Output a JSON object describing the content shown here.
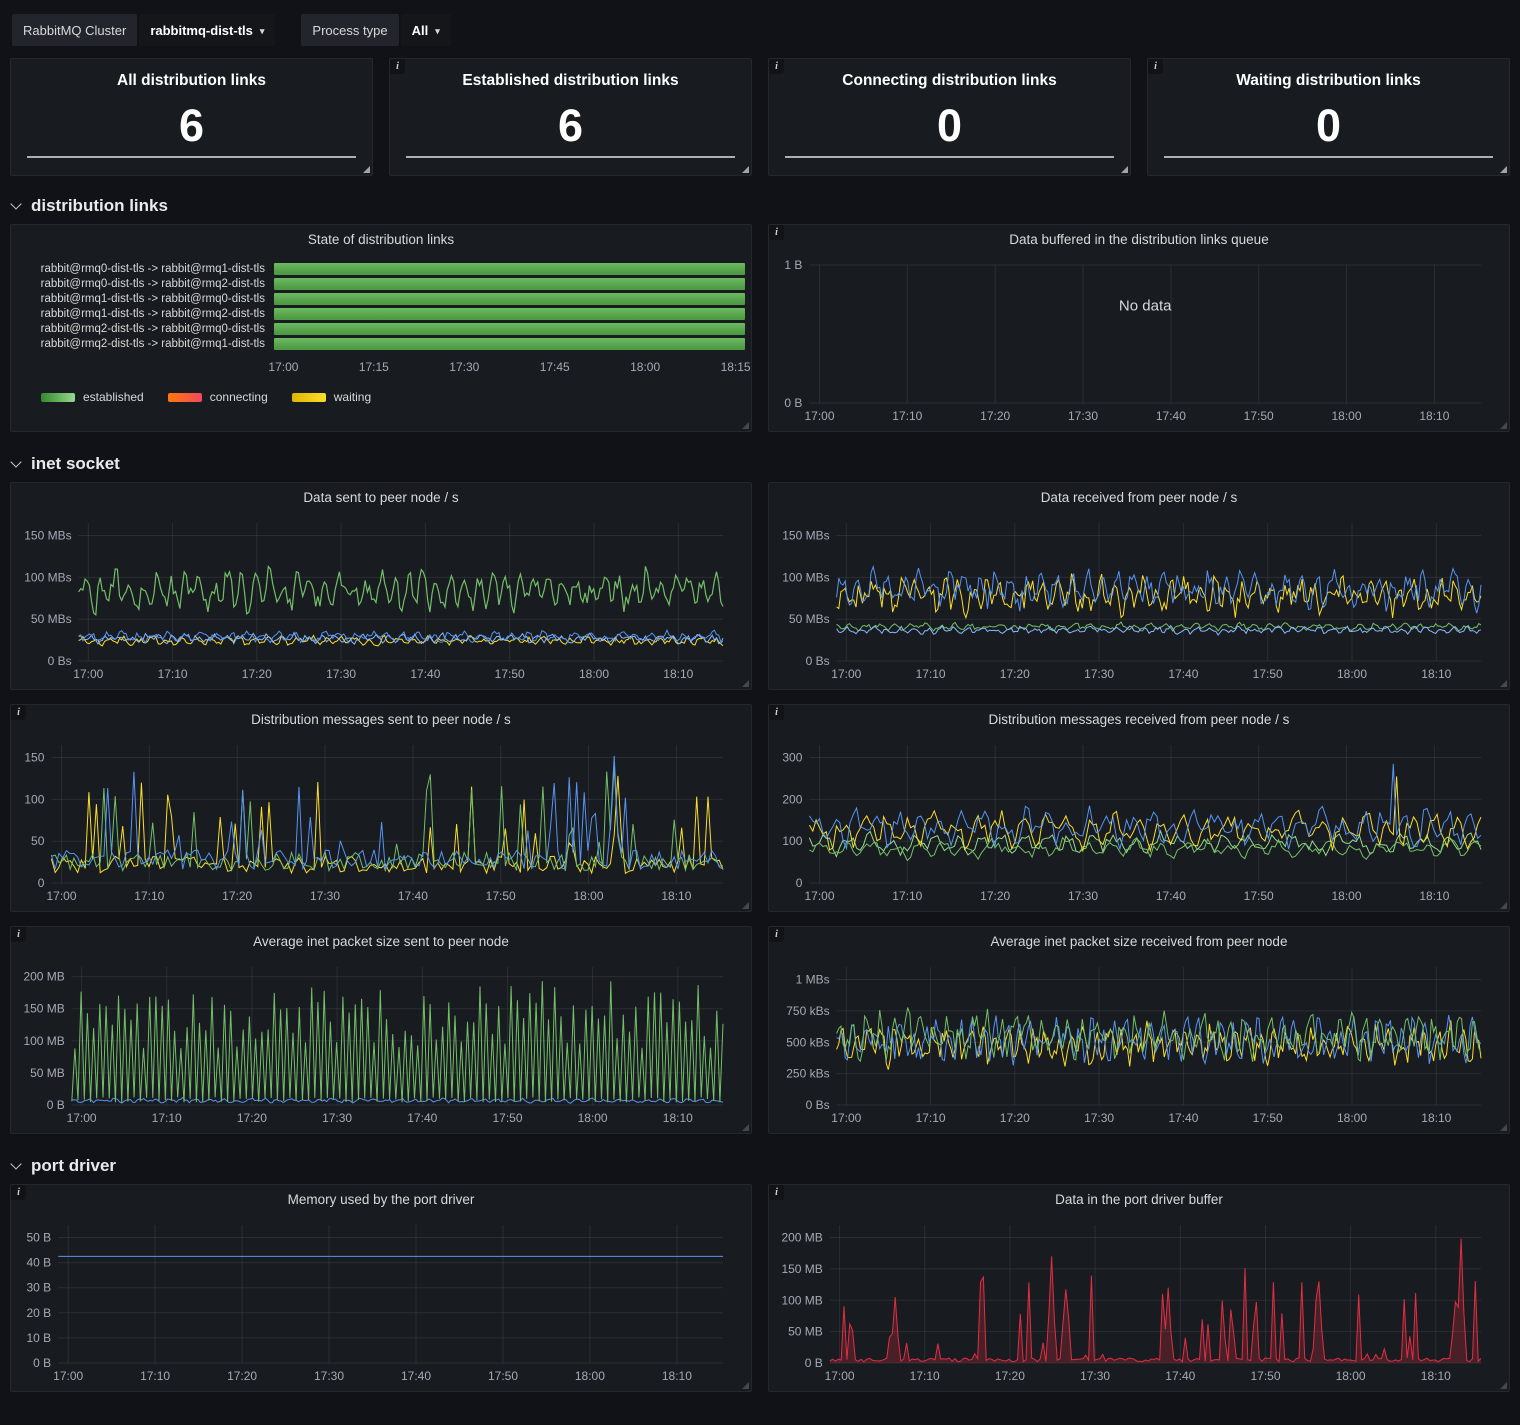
{
  "ui": {
    "info_glyph": "i",
    "caret": "▾"
  },
  "topbar": {
    "cluster_label": "RabbitMQ Cluster",
    "cluster_value": "rabbitmq-dist-tls",
    "process_label": "Process type",
    "process_value": "All"
  },
  "stat_panels": [
    {
      "title": "All distribution links",
      "value": "6"
    },
    {
      "title": "Established distribution links",
      "value": "6"
    },
    {
      "title": "Connecting distribution links",
      "value": "0"
    },
    {
      "title": "Waiting distribution links",
      "value": "0"
    }
  ],
  "sections": {
    "distribution_links": "distribution links",
    "inet_socket": "inet socket",
    "port_driver": "port driver"
  },
  "chart_data": {
    "state_links": {
      "type": "state-timeline",
      "title": "State of distribution links",
      "rows": [
        {
          "label": "rabbit@rmq0-dist-tls -> rabbit@rmq1-dist-tls",
          "state": "established"
        },
        {
          "label": "rabbit@rmq0-dist-tls -> rabbit@rmq2-dist-tls",
          "state": "established"
        },
        {
          "label": "rabbit@rmq1-dist-tls -> rabbit@rmq0-dist-tls",
          "state": "established"
        },
        {
          "label": "rabbit@rmq1-dist-tls -> rabbit@rmq2-dist-tls",
          "state": "established"
        },
        {
          "label": "rabbit@rmq2-dist-tls -> rabbit@rmq0-dist-tls",
          "state": "established"
        },
        {
          "label": "rabbit@rmq2-dist-tls -> rabbit@rmq1-dist-tls",
          "state": "established"
        }
      ],
      "x_ticks": [
        "17:00",
        "17:15",
        "17:30",
        "17:45",
        "18:00",
        "18:15"
      ],
      "legend": [
        {
          "label": "established",
          "color_from": "#37872d",
          "color_to": "#96d98d"
        },
        {
          "label": "connecting",
          "color_from": "#ff780a",
          "color_to": "#f2495c"
        },
        {
          "label": "waiting",
          "color_from": "#e0b400",
          "color_to": "#fade2a"
        }
      ],
      "bar_color": "#56a64b"
    },
    "buffered": {
      "type": "line",
      "title": "Data buffered in the distribution links queue",
      "no_data": "No data",
      "ylim": [
        0,
        1
      ],
      "y_ticks": [
        {
          "v": 0,
          "label": "0 B"
        },
        {
          "v": 1,
          "label": "1 B"
        }
      ],
      "x_ticks": [
        "17:00",
        "17:10",
        "17:20",
        "17:30",
        "17:40",
        "17:50",
        "18:00",
        "18:10"
      ],
      "series": []
    },
    "data_sent": {
      "type": "line",
      "title": "Data sent to peer node / s",
      "ylim": [
        0,
        165
      ],
      "y_ticks": [
        {
          "v": 0,
          "label": "0 Bs"
        },
        {
          "v": 50,
          "label": "50 MBs"
        },
        {
          "v": 100,
          "label": "100 MBs"
        },
        {
          "v": 150,
          "label": "150 MBs"
        }
      ],
      "x_ticks": [
        "17:00",
        "17:10",
        "17:20",
        "17:30",
        "17:40",
        "17:50",
        "18:00",
        "18:10"
      ],
      "series": [
        {
          "color": "#fade2a",
          "mode": "noise",
          "base": 24,
          "amp": 6,
          "freq": 280,
          "seed": 7
        },
        {
          "color": "#8ab8ff",
          "mode": "noise",
          "base": 27,
          "amp": 6,
          "freq": 300,
          "seed": 8
        },
        {
          "color": "#5794f2",
          "mode": "noise",
          "base": 29,
          "amp": 7,
          "freq": 260,
          "seed": 9
        },
        {
          "color": "#73bf69",
          "mode": "noise",
          "base": 84,
          "amp": 26,
          "freq": 290,
          "seed": 10,
          "lw": 1.2
        }
      ]
    },
    "data_received": {
      "type": "line",
      "title": "Data received from peer node / s",
      "ylim": [
        0,
        165
      ],
      "y_ticks": [
        {
          "v": 0,
          "label": "0 Bs"
        },
        {
          "v": 50,
          "label": "50 MBs"
        },
        {
          "v": 100,
          "label": "100 MBs"
        },
        {
          "v": 150,
          "label": "150 MBs"
        }
      ],
      "x_ticks": [
        "17:00",
        "17:10",
        "17:20",
        "17:30",
        "17:40",
        "17:50",
        "18:00",
        "18:10"
      ],
      "series": [
        {
          "color": "#73bf69",
          "mode": "noise",
          "base": 41,
          "amp": 5,
          "freq": 270,
          "seed": 21
        },
        {
          "color": "#8ab8ff",
          "mode": "noise",
          "base": 37,
          "amp": 5,
          "freq": 300,
          "seed": 22
        },
        {
          "color": "#fade2a",
          "mode": "noise",
          "base": 79,
          "amp": 24,
          "freq": 285,
          "seed": 23
        },
        {
          "color": "#5794f2",
          "mode": "noise",
          "base": 86,
          "amp": 25,
          "freq": 265,
          "seed": 24
        }
      ]
    },
    "msgs_sent": {
      "type": "line",
      "title": "Distribution messages sent to peer node / s",
      "ylim": [
        0,
        165
      ],
      "y_ticks": [
        {
          "v": 0,
          "label": "0"
        },
        {
          "v": 50,
          "label": "50"
        },
        {
          "v": 100,
          "label": "100"
        },
        {
          "v": 150,
          "label": "150"
        }
      ],
      "x_ticks": [
        "17:00",
        "17:10",
        "17:20",
        "17:30",
        "17:40",
        "17:50",
        "18:00",
        "18:10"
      ],
      "series": [
        {
          "color": "#fade2a",
          "mode": "spiky",
          "base": 7,
          "amp": 115,
          "seed": 31,
          "points": 180,
          "peaks": [
            {
              "t": 0.845,
              "v": 128
            }
          ]
        },
        {
          "color": "#73bf69",
          "mode": "spiky",
          "base": 9,
          "amp": 125,
          "seed": 32,
          "points": 180,
          "peaks": [
            {
              "t": 0.84,
              "v": 140
            }
          ]
        },
        {
          "color": "#5794f2",
          "mode": "spiky",
          "base": 11,
          "amp": 130,
          "seed": 33,
          "points": 180,
          "peaks": [
            {
              "t": 0.84,
              "v": 152
            }
          ]
        }
      ]
    },
    "msgs_received": {
      "type": "line",
      "title": "Distribution messages received from peer node / s",
      "ylim": [
        0,
        330
      ],
      "y_ticks": [
        {
          "v": 0,
          "label": "0"
        },
        {
          "v": 100,
          "label": "100"
        },
        {
          "v": 200,
          "label": "200"
        },
        {
          "v": 300,
          "label": "300"
        }
      ],
      "x_ticks": [
        "17:00",
        "17:10",
        "17:20",
        "17:30",
        "17:40",
        "17:50",
        "18:00",
        "18:10"
      ],
      "series": [
        {
          "color": "#96d98d",
          "mode": "noise",
          "base": 95,
          "amp": 28,
          "freq": 190,
          "seed": 41,
          "points": 200
        },
        {
          "color": "#73bf69",
          "mode": "noise",
          "base": 82,
          "amp": 24,
          "freq": 175,
          "seed": 42,
          "points": 200
        },
        {
          "color": "#fade2a",
          "mode": "noise",
          "base": 126,
          "amp": 44,
          "freq": 185,
          "seed": 43,
          "points": 200,
          "peaks": [
            {
              "t": 0.875,
              "v": 255
            }
          ]
        },
        {
          "color": "#5794f2",
          "mode": "noise",
          "base": 134,
          "amp": 48,
          "freq": 200,
          "seed": 44,
          "points": 200,
          "peaks": [
            {
              "t": 0.87,
              "v": 285
            }
          ]
        }
      ]
    },
    "pkt_sent": {
      "type": "line",
      "title": "Average inet packet size sent to peer node",
      "ylim": [
        0,
        215
      ],
      "y_ticks": [
        {
          "v": 0,
          "label": "0 B"
        },
        {
          "v": 50,
          "label": "50 MB"
        },
        {
          "v": 100,
          "label": "100 MB"
        },
        {
          "v": 150,
          "label": "150 MB"
        },
        {
          "v": 200,
          "label": "200 MB"
        }
      ],
      "x_ticks": [
        "17:00",
        "17:10",
        "17:20",
        "17:30",
        "17:40",
        "17:50",
        "18:00",
        "18:10"
      ],
      "series": [
        {
          "color": "#5794f2",
          "mode": "noise",
          "base": 7,
          "amp": 4,
          "freq": 300,
          "seed": 51
        },
        {
          "color": "#73bf69",
          "mode": "comb",
          "base": 4,
          "amp": 195,
          "seed": 52,
          "points": 210
        }
      ]
    },
    "pkt_received": {
      "type": "line",
      "title": "Average inet packet size received from peer node",
      "ylim": [
        0,
        1100
      ],
      "y_ticks": [
        {
          "v": 0,
          "label": "0 Bs"
        },
        {
          "v": 250,
          "label": "250 kBs"
        },
        {
          "v": 500,
          "label": "500 kBs"
        },
        {
          "v": 750,
          "label": "750 kBs"
        },
        {
          "v": 1000,
          "label": "1 MBs"
        }
      ],
      "x_ticks": [
        "17:00",
        "17:10",
        "17:20",
        "17:30",
        "17:40",
        "17:50",
        "18:00",
        "18:10"
      ],
      "series": [
        {
          "color": "#fade2a",
          "mode": "noise",
          "base": 480,
          "amp": 170,
          "freq": 320,
          "seed": 61
        },
        {
          "color": "#5794f2",
          "mode": "noise",
          "base": 520,
          "amp": 190,
          "freq": 340,
          "seed": 62
        },
        {
          "color": "#73bf69",
          "mode": "noise",
          "base": 560,
          "amp": 200,
          "freq": 300,
          "seed": 63
        }
      ]
    },
    "port_memory": {
      "type": "line",
      "title": "Memory used by the port driver",
      "ylim": [
        0,
        55
      ],
      "y_ticks": [
        {
          "v": 0,
          "label": "0 B"
        },
        {
          "v": 10,
          "label": "10 B"
        },
        {
          "v": 20,
          "label": "20 B"
        },
        {
          "v": 30,
          "label": "30 B"
        },
        {
          "v": 40,
          "label": "40 B"
        },
        {
          "v": 50,
          "label": "50 B"
        }
      ],
      "x_ticks": [
        "17:00",
        "17:10",
        "17:20",
        "17:30",
        "17:40",
        "17:50",
        "18:00",
        "18:10"
      ],
      "series": [
        {
          "color": "#5794f2",
          "mode": "flat",
          "base": 42.5,
          "points": 4
        }
      ]
    },
    "port_buffer": {
      "type": "line",
      "title": "Data in the port driver buffer",
      "ylim": [
        0,
        220
      ],
      "y_ticks": [
        {
          "v": 0,
          "label": "0 B"
        },
        {
          "v": 50,
          "label": "50 MB"
        },
        {
          "v": 100,
          "label": "100 MB"
        },
        {
          "v": 150,
          "label": "150 MB"
        },
        {
          "v": 200,
          "label": "200 MB"
        }
      ],
      "x_ticks": [
        "17:00",
        "17:10",
        "17:20",
        "17:30",
        "17:40",
        "17:50",
        "18:00",
        "18:10"
      ],
      "series": [
        {
          "color": "#e02f44",
          "mode": "area-spikes",
          "base": 2,
          "amp": 150,
          "seed": 71,
          "points": 230,
          "fill": "rgba(224,47,68,0.25)",
          "peaks": [
            {
              "t": 0.1,
              "v": 105
            },
            {
              "t": 0.34,
              "v": 170
            },
            {
              "t": 0.52,
              "v": 120
            },
            {
              "t": 0.75,
              "v": 130
            },
            {
              "t": 0.97,
              "v": 198
            }
          ]
        }
      ]
    }
  }
}
